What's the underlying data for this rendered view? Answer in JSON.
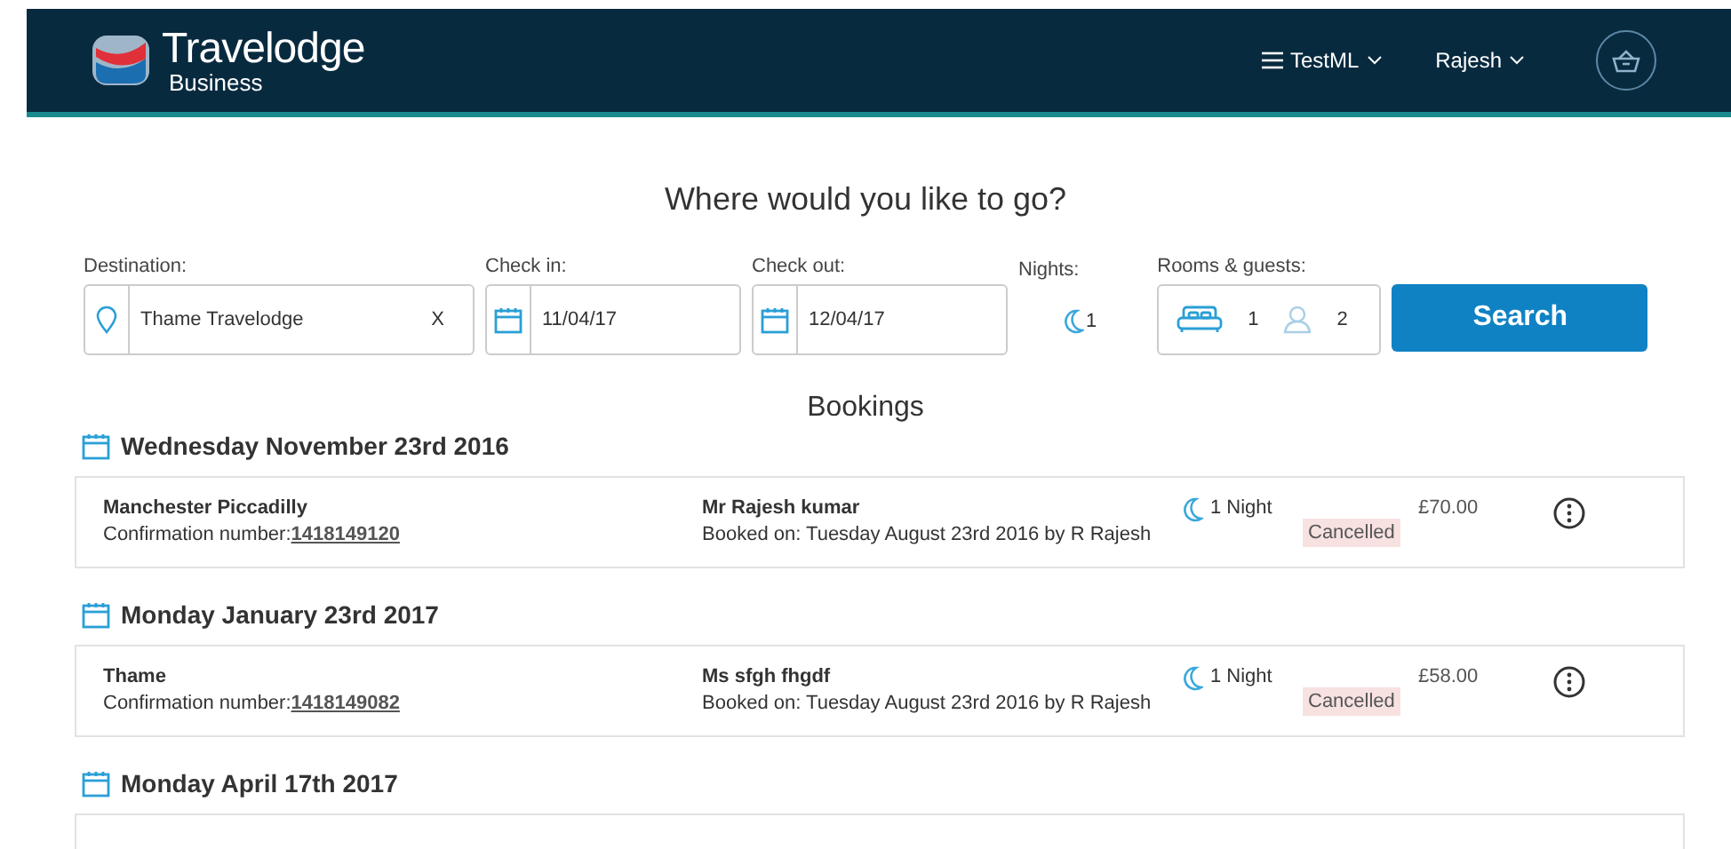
{
  "header": {
    "brand": "Travelodge",
    "sub_brand": "Business",
    "menu": "TestML",
    "user": "Rajesh"
  },
  "search": {
    "title": "Where would you like to go?",
    "destination": {
      "label": "Destination:",
      "value": "Thame Travelodge",
      "clear": "X"
    },
    "check_in": {
      "label": "Check in:",
      "value": "11/04/17"
    },
    "check_out": {
      "label": "Check out:",
      "value": "12/04/17"
    },
    "nights": {
      "label": "Nights:",
      "value": "1"
    },
    "rooms_guests": {
      "label": "Rooms & guests:",
      "rooms": "1",
      "guests": "2"
    },
    "button": "Search"
  },
  "bookings": {
    "title": "Bookings",
    "groups": [
      {
        "date": "Wednesday November 23rd 2016",
        "hotel": "Manchester Piccadilly",
        "confirmation_label": "Confirmation number:",
        "confirmation": "1418149120",
        "guest": "Mr Rajesh kumar",
        "booked_on": "Booked on: Tuesday August 23rd 2016 by R Rajesh",
        "nights": "1 Night",
        "status": "Cancelled",
        "price": "£70.00"
      },
      {
        "date": "Monday January 23rd 2017",
        "hotel": "Thame",
        "confirmation_label": "Confirmation number:",
        "confirmation": "1418149082",
        "guest": "Ms sfgh fhgdf",
        "booked_on": "Booked on: Tuesday August 23rd 2016 by R Rajesh",
        "nights": "1 Night",
        "status": "Cancelled",
        "price": "£58.00"
      },
      {
        "date": "Monday April 17th 2017"
      }
    ]
  }
}
